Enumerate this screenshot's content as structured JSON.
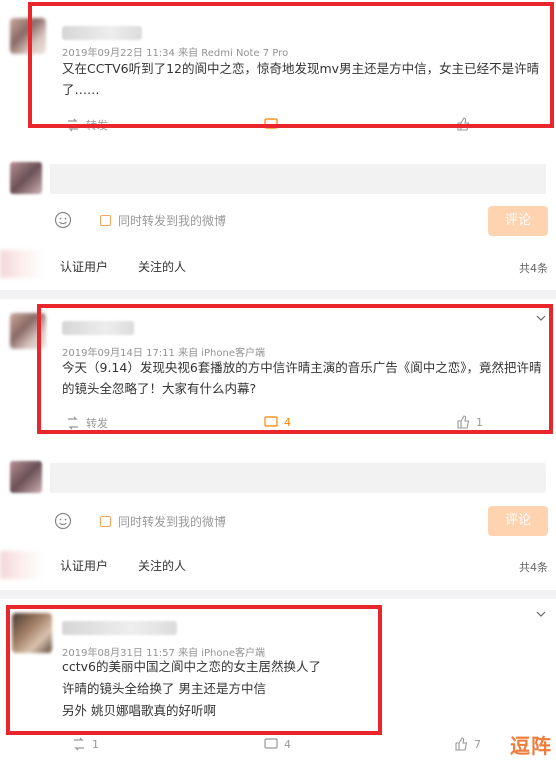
{
  "posts": [
    {
      "meta": "2019年09月22日 11:34  来自 Redmi Note 7 Pro",
      "lines": [
        "又在CCTV6听到了12的阆中之恋，惊奇地发现mv男主还是方中信，女主已经不是许晴",
        "了……"
      ],
      "repost_label": "转发",
      "comment_count": "",
      "like_count": ""
    },
    {
      "meta": "2019年09月14日 17:11  来自 iPhone客户端",
      "lines": [
        "今天（9.14）发现央视6套播放的方中信许晴主演的音乐广告《阆中之恋》，竟然把许晴",
        "的镜头全忽略了！大家有什么内幕?"
      ],
      "repost_label": "转发",
      "comment_count": "4",
      "like_count": "1"
    },
    {
      "meta": "2019年08月31日 11:57  来自 iPhone客户端",
      "lines": [
        "cctv6的美丽中国之阆中之恋的女主居然换人了",
        "许晴的镜头全给换了 男主还是方中信",
        "另外 姚贝娜唱歌真的好听啊"
      ],
      "repost_label": "1",
      "comment_count": "4",
      "like_count": "7"
    }
  ],
  "comment_box": {
    "repost_checkbox_label": "同时转发到我的微博",
    "submit_label": "评论",
    "tab_verified": "认证用户",
    "tab_following": "关注的人",
    "total_1": "共4条",
    "total_2": "共4条"
  },
  "watermark": "逗阵",
  "icons": [
    "repost-icon",
    "comment-icon",
    "like-icon",
    "smile-icon",
    "chevron-down-icon"
  ],
  "colors": {
    "highlight_box": "#e9262c",
    "accent": "#ff8200",
    "submit_bg": "#ffd3b0"
  }
}
